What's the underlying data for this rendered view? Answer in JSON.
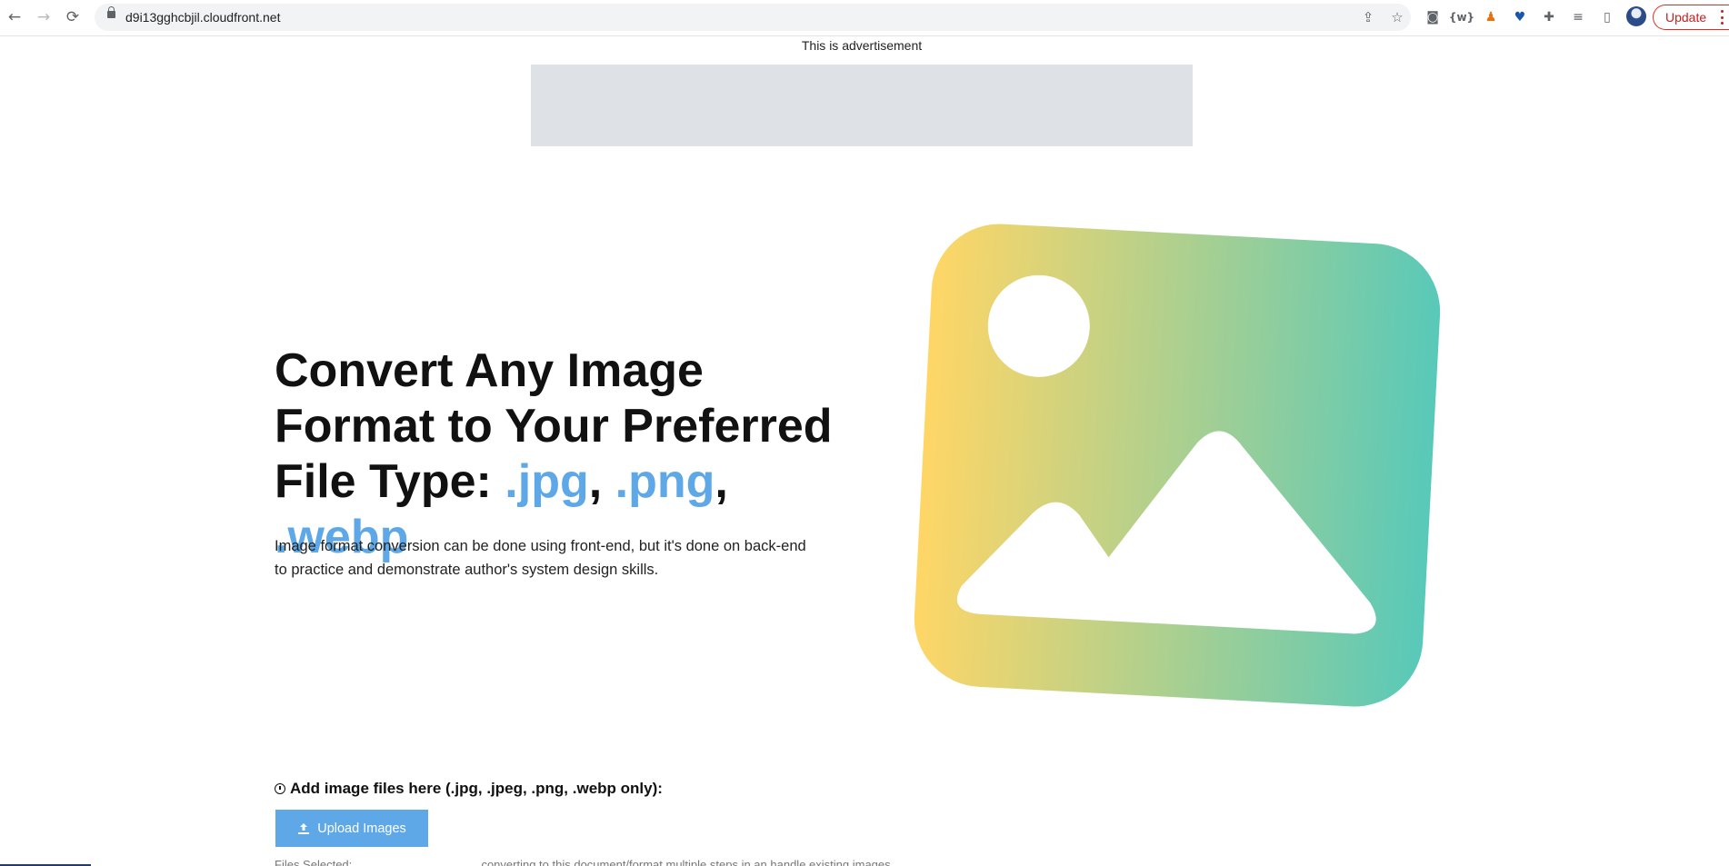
{
  "browser": {
    "url": "d9i13gghcbjil.cloudfront.net",
    "update_label": "Update",
    "extensions": [
      "camera-icon",
      "word-tune-icon",
      "chess-icon",
      "heart-shield-icon",
      "puzzle-icon",
      "reading-list-icon",
      "side-panel-icon"
    ]
  },
  "ad": {
    "label": "This is advertisement"
  },
  "hero": {
    "line1": "Convert Any Image",
    "line2": "Format to Your Preferred",
    "line3_prefix": "File Type: ",
    "ext1": ".jpg",
    "ext2": ".png",
    "ext3": ".webp",
    "comma": ",",
    "description": "Image format conversion can be done using front-end, but it's done on back-end to practice and demonstrate author's system design skills.",
    "art_gradient": [
      "#ffd666",
      "#58c9b9"
    ]
  },
  "upload": {
    "instructions": "Add image files here (.jpg, .jpeg, .png, .webp only):",
    "button_label": "Upload Images",
    "partial_left": "Files Selected:",
    "partial_middle": "... converting to this document/format multiple steps in an handle existing images"
  }
}
